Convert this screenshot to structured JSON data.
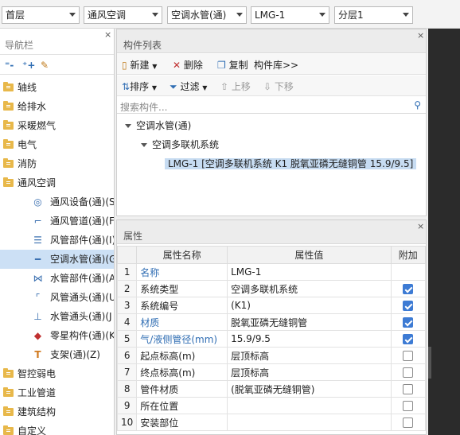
{
  "topbar": {
    "floor": "首层",
    "discipline": "通风空调",
    "component_type": "空调水管(通)",
    "component": "LMG-1",
    "layer": "分层1"
  },
  "nav": {
    "title": "导航栏",
    "close": "×",
    "items": [
      {
        "label": "轴线"
      },
      {
        "label": "给排水"
      },
      {
        "label": "采暖燃气"
      },
      {
        "label": "电气"
      },
      {
        "label": "消防"
      },
      {
        "label": "通风空调"
      }
    ],
    "subitems": [
      {
        "label": "通风设备(通)(S",
        "icon": "fan-device-icon",
        "glyph": "◎"
      },
      {
        "label": "通风管道(通)(F",
        "icon": "duct-icon",
        "glyph": "⌐"
      },
      {
        "label": "风管部件(通)(I)",
        "icon": "duct-part-icon",
        "glyph": "☰"
      },
      {
        "label": "空调水管(通)(G",
        "icon": "water-pipe-icon",
        "glyph": "━"
      },
      {
        "label": "水管部件(通)(A",
        "icon": "pipe-part-icon",
        "glyph": "⋈"
      },
      {
        "label": "风管通头(通)(U",
        "icon": "duct-fitting-icon",
        "glyph": "⌜"
      },
      {
        "label": "水管通头(通)(J",
        "icon": "pipe-fitting-icon",
        "glyph": "⊥"
      },
      {
        "label": "零星构件(通)(K",
        "icon": "misc-part-icon",
        "glyph": "◆"
      },
      {
        "label": "支架(通)(Z)",
        "icon": "support-icon",
        "glyph": "T"
      }
    ],
    "items2": [
      {
        "label": "智控弱电"
      },
      {
        "label": "工业管道"
      },
      {
        "label": "建筑结构"
      },
      {
        "label": "自定义"
      }
    ]
  },
  "component_list": {
    "title": "构件列表",
    "close": "×",
    "new_label": "新建",
    "delete_label": "删除",
    "copy_label": "复制",
    "library_label": "构件库>>",
    "sort_label": "排序",
    "filter_label": "过滤",
    "up_label": "上移",
    "down_label": "下移",
    "search_placeholder": "搜索构件...",
    "tree": {
      "root": "空调水管(通)",
      "child": "空调多联机系统",
      "leaf": "LMG-1 [空调多联机系统 K1 脱氧亚磷无缝铜管 15.9/9.5]"
    }
  },
  "properties": {
    "title": "属性",
    "close": "×",
    "headers": {
      "name": "属性名称",
      "value": "属性值",
      "extra": "附加"
    },
    "rows": [
      {
        "idx": "1",
        "name": "名称",
        "value": "LMG-1",
        "blue": true,
        "checkbox": null
      },
      {
        "idx": "2",
        "name": "系统类型",
        "value": "空调多联机系统",
        "blue": false,
        "checkbox": true
      },
      {
        "idx": "3",
        "name": "系统编号",
        "value": "(K1)",
        "blue": false,
        "checkbox": true
      },
      {
        "idx": "4",
        "name": "材质",
        "value": "脱氧亚磷无缝铜管",
        "blue": true,
        "checkbox": true
      },
      {
        "idx": "5",
        "name": "气/液侧管径(mm)",
        "value": "15.9/9.5",
        "blue": true,
        "checkbox": true
      },
      {
        "idx": "6",
        "name": "起点标高(m)",
        "value": "层顶标高",
        "blue": false,
        "checkbox": false
      },
      {
        "idx": "7",
        "name": "终点标高(m)",
        "value": "层顶标高",
        "blue": false,
        "checkbox": false
      },
      {
        "idx": "8",
        "name": "管件材质",
        "value": "(脱氧亚磷无缝铜管)",
        "blue": false,
        "checkbox": false
      },
      {
        "idx": "9",
        "name": "所在位置",
        "value": "",
        "blue": false,
        "checkbox": false
      },
      {
        "idx": "10",
        "name": "安装部位",
        "value": "",
        "blue": false,
        "checkbox": false
      }
    ]
  }
}
